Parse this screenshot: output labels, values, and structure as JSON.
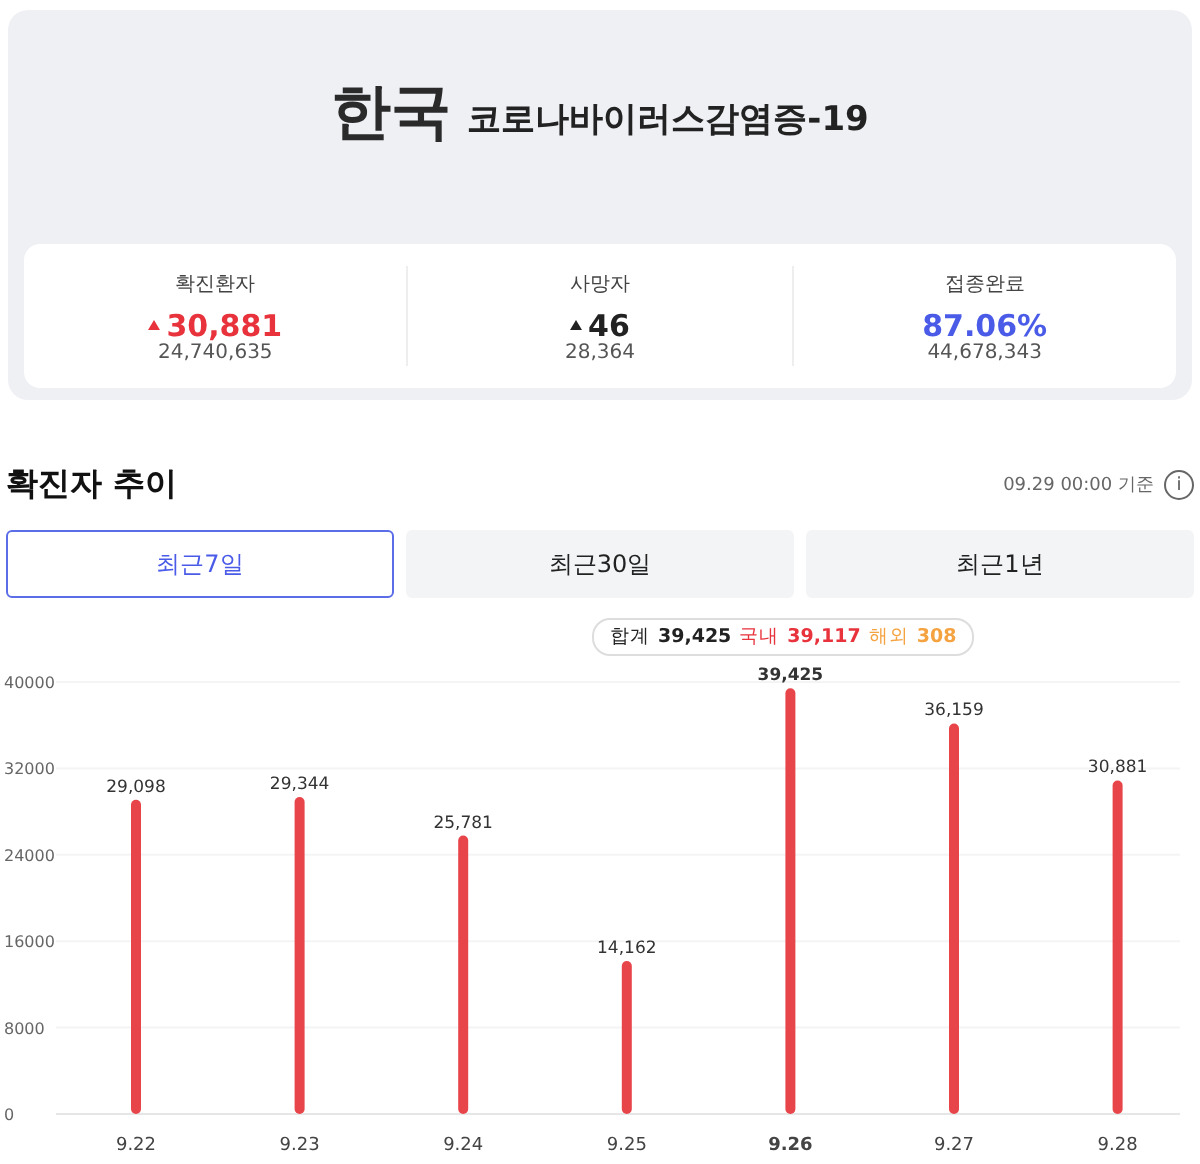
{
  "header": {
    "country": "한국",
    "disease": "코로나바이러스감염증-19"
  },
  "stats": [
    {
      "label": "확진환자",
      "value": "30,881",
      "total": "24,740,635",
      "kind": "up",
      "color": "#e8323c"
    },
    {
      "label": "사망자",
      "value": "46",
      "total": "28,364",
      "kind": "up",
      "color": "#222222"
    },
    {
      "label": "접종완료",
      "value": "87.06%",
      "total": "44,678,343",
      "kind": "plain",
      "color": "#4a5be8"
    }
  ],
  "section": {
    "title": "확진자 추이",
    "timestamp": "09.29 00:00 기준",
    "info_icon": "i"
  },
  "tabs": [
    {
      "label": "최근7일",
      "selected": true
    },
    {
      "label": "최근30일",
      "selected": false
    },
    {
      "label": "최근1년",
      "selected": false
    }
  ],
  "chart": {
    "selected_category": "9.26",
    "tooltip": {
      "total_label": "합계",
      "total": "39,425",
      "domestic_label": "국내",
      "domestic": "39,117",
      "overseas_label": "해외",
      "overseas": "308"
    },
    "chart_data": {
      "type": "bar",
      "categories": [
        "9.22",
        "9.23",
        "9.24",
        "9.25",
        "9.26",
        "9.27",
        "9.28"
      ],
      "grid": true,
      "series": [
        {
          "color": "#e8454a",
          "values": [
            29098,
            29344,
            25781,
            14162,
            39425,
            36159,
            30881
          ]
        }
      ],
      "value_labels": [
        "29,098",
        "29,344",
        "25,781",
        "14,162",
        "39,425",
        "36,159",
        "30,881"
      ],
      "ylim": [
        0,
        40000
      ],
      "yticks": [
        0,
        8000,
        16000,
        24000,
        32000,
        40000
      ]
    }
  }
}
